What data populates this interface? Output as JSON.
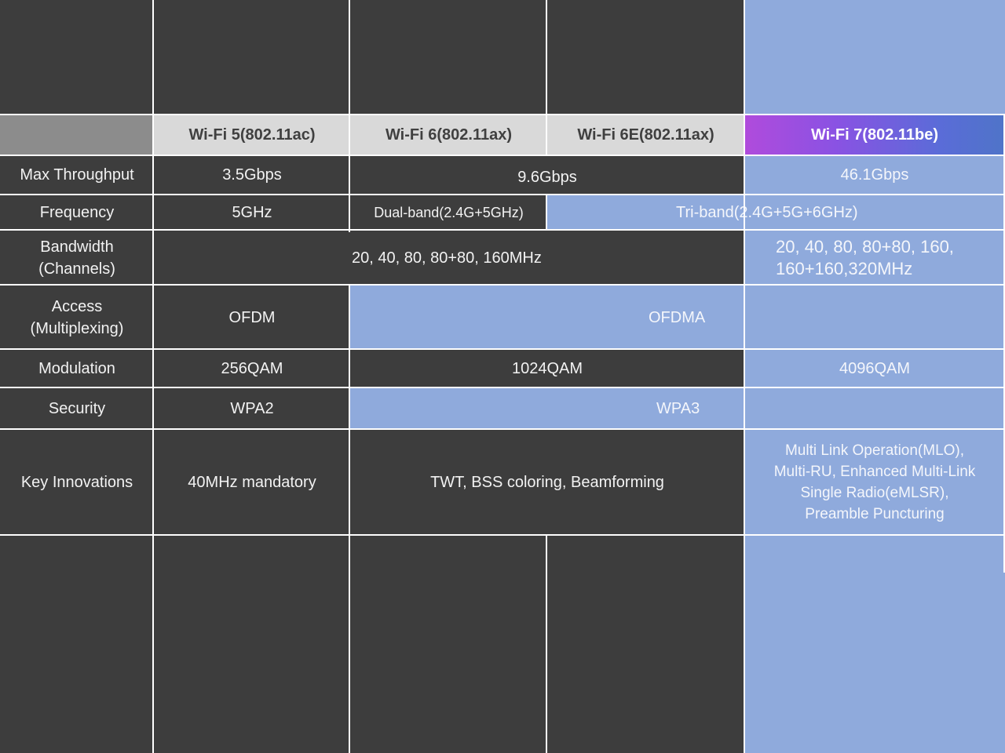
{
  "headers": {
    "wifi5": "Wi-Fi 5(802.11ac)",
    "wifi6": "Wi-Fi 6(802.11ax)",
    "wifi6e": "Wi-Fi 6E(802.11ax)",
    "wifi7": "Wi-Fi 7(802.11be)"
  },
  "rows": {
    "throughput": {
      "label": "Max Throughput",
      "wifi5": "3.5Gbps",
      "wifi6_6e": "9.6Gbps",
      "wifi7": "46.1Gbps"
    },
    "frequency": {
      "label": "Frequency",
      "wifi5": "5GHz",
      "wifi6": "Dual-band(2.4G+5GHz)",
      "wifi6e_7": "Tri-band(2.4G+5G+6GHz)"
    },
    "bandwidth": {
      "label_line1": "Bandwidth",
      "label_line2": "(Channels)",
      "wifi6_6e": "20, 40, 80, 80+80, 160MHz",
      "wifi7_line1": "20, 40, 80, 80+80, 160,",
      "wifi7_line2": "160+160,320MHz"
    },
    "access": {
      "label_line1": "Access",
      "label_line2": "(Multiplexing)",
      "wifi5": "OFDM",
      "wifi6_6e_7": "OFDMA"
    },
    "modulation": {
      "label": "Modulation",
      "wifi5": "256QAM",
      "wifi6_6e": "1024QAM",
      "wifi7": "4096QAM"
    },
    "security": {
      "label": "Security",
      "wifi5": "WPA2",
      "wifi6_6e_7": "WPA3"
    },
    "innovations": {
      "label": "Key Innovations",
      "wifi5": "40MHz mandatory",
      "wifi6_6e": "TWT, BSS coloring, Beamforming",
      "wifi7_line1": "Multi Link Operation(MLO),",
      "wifi7_line2": "Multi-RU, Enhanced Multi-Link",
      "wifi7_line3": "Single Radio(eMLSR),",
      "wifi7_line4": "Preamble Puncturing"
    }
  },
  "colors": {
    "dark": "#3d3d3d",
    "blue": "#8faadc",
    "header_gray": "#d9d9d9",
    "corner_gray": "#8c8c8c",
    "gradient_start": "#b04bdc",
    "gradient_end": "#4f74c8"
  }
}
